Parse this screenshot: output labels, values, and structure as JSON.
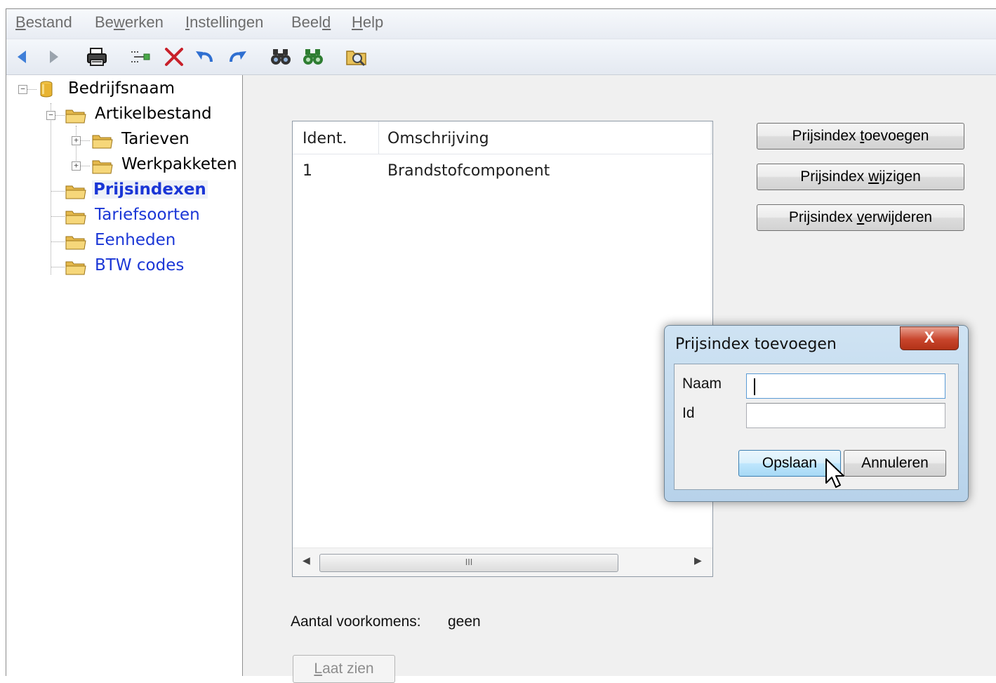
{
  "menubar": {
    "items": [
      {
        "pre": "",
        "key": "B",
        "post": "estand"
      },
      {
        "pre": "Be",
        "key": "w",
        "post": "erken"
      },
      {
        "pre": "",
        "key": "I",
        "post": "nstellingen"
      },
      {
        "pre": "Beel",
        "key": "d",
        "post": ""
      },
      {
        "pre": "",
        "key": "H",
        "post": "elp"
      }
    ]
  },
  "toolbar": {
    "icons": [
      "back-arrow-icon",
      "forward-arrow-icon",
      "print-icon",
      "connect-icon",
      "delete-x-icon",
      "undo-icon",
      "redo-icon",
      "find-binoculars-icon",
      "find-next-binoculars-icon",
      "search-folder-icon"
    ]
  },
  "tree": {
    "root": "Bedrijfsnaam",
    "artikelbestand": "Artikelbestand",
    "tarieven": "Tarieven",
    "werkpakketen": "Werkpakketen",
    "prijsindexen": "Prijsindexen",
    "tariefsoorten": "Tariefsoorten",
    "eenheden": "Eenheden",
    "btw": "BTW codes"
  },
  "list": {
    "columns": [
      "Ident.",
      "Omschrijving"
    ],
    "rows": [
      {
        "ident": "1",
        "omschrijving": "Brandstofcomponent"
      }
    ],
    "scroll_grip": "III"
  },
  "actions": {
    "add": {
      "pre": "Prijsindex ",
      "key": "t",
      "post": "oevoegen"
    },
    "edit": {
      "pre": "Prijsindex ",
      "key": "w",
      "post": "ijzigen"
    },
    "delete": {
      "pre": "Prijsindex ",
      "key": "v",
      "post": "erwijderen"
    }
  },
  "footer": {
    "count_label": "Aantal voorkomens:",
    "count_value": "geen",
    "show_pre": "",
    "show_key": "L",
    "show_post": "aat zien"
  },
  "dialog": {
    "title": "Prijsindex toevoegen",
    "close_glyph": "X",
    "name_label": "Naam",
    "name_value": "",
    "id_label": "Id",
    "id_value": "",
    "save_label": "Opslaan",
    "cancel_label": "Annuleren"
  },
  "colors": {
    "link": "#1a36d6",
    "folder": "#e8c25a",
    "close_button": "#c8452c",
    "dialog_frame": "#b7d2ea"
  }
}
